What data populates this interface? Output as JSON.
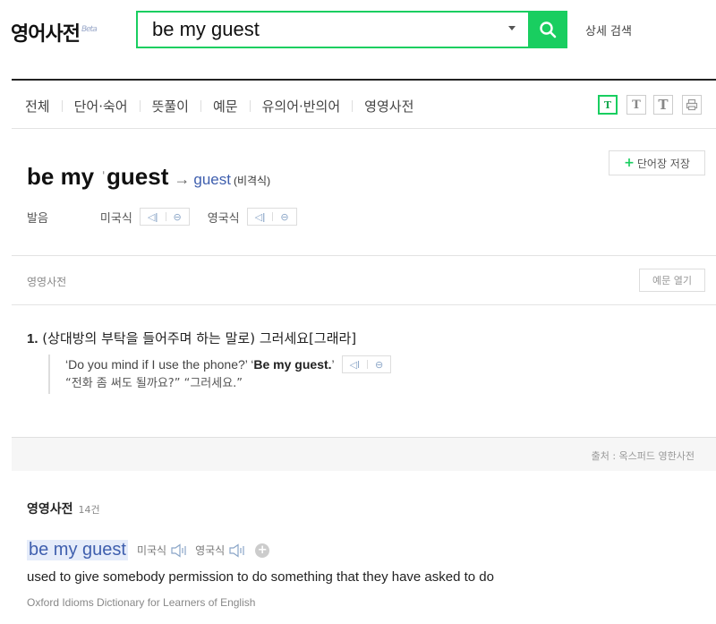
{
  "header": {
    "logo": "영어사전",
    "beta": "Beta",
    "search_value": "be my guest",
    "advanced_search": "상세 검색",
    "search_icon": "search-icon"
  },
  "tabs": [
    "전체",
    "단어·숙어",
    "뜻풀이",
    "예문",
    "유의어·반의어",
    "영영사전"
  ],
  "font_size_buttons": [
    "T",
    "T",
    "T"
  ],
  "print_icon": "print-icon",
  "entry": {
    "word_prefix": "be my ",
    "stress_mark": "ˈ",
    "word_main": "guest",
    "arrow": "→",
    "related": "guest",
    "register": "(비격식)",
    "save_label": "단어장 저장",
    "pron_label": "발음",
    "us_label": "미국식",
    "uk_label": "영국식"
  },
  "section": {
    "title": "영영사전",
    "example_toggle": "예문 열기"
  },
  "definition": {
    "number": "1.",
    "text": "(상대방의 부탁을 들어주며 하는 말로) 그러세요[그래라]",
    "example_before": "‘Do you mind if I use the phone?’ ‘",
    "example_bold": "Be my guest.",
    "example_after": "’",
    "translation": "“전화 좀 써도 될까요?” “그러세요.”"
  },
  "source": "출처 : 옥스퍼드 영한사전",
  "ee": {
    "title": "영영사전",
    "count": "14건",
    "word": "be my guest",
    "us_label": "미국식",
    "uk_label": "영국식",
    "definition": "used to give somebody permission to do something that they have asked to do",
    "source": "Oxford Idioms Dictionary for Learners of English"
  },
  "colors": {
    "accent": "#19ce60",
    "link": "#3f5fae"
  }
}
